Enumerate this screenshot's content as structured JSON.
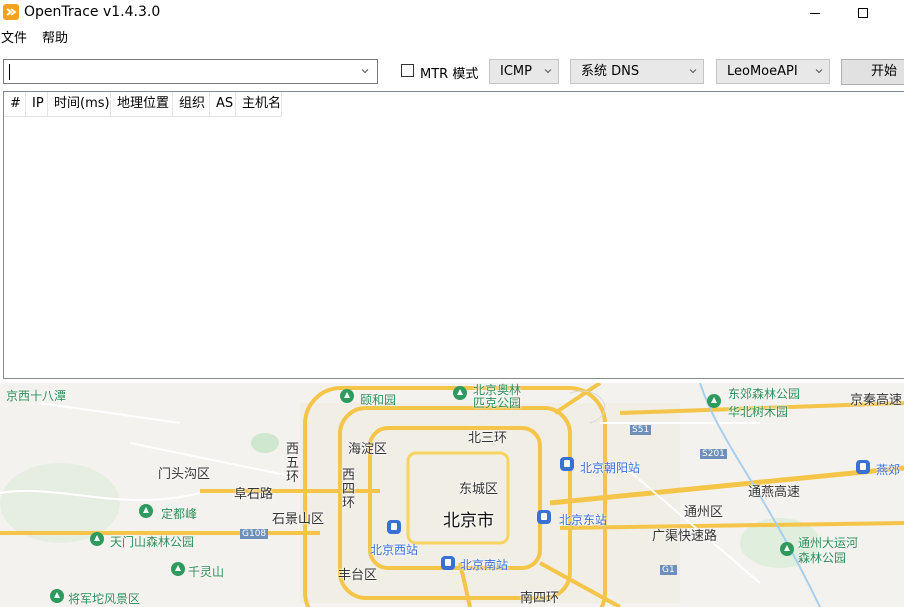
{
  "window": {
    "title": "OpenTrace v1.4.3.0"
  },
  "menu": {
    "items": [
      "文件",
      "帮助"
    ]
  },
  "toolbar": {
    "target_value": "",
    "mtr_label": "MTR 模式",
    "mtr_checked": false,
    "protocol": "ICMP",
    "dns": "系统 DNS",
    "api": "LeoMoeAPI",
    "start_label": "开始"
  },
  "table": {
    "columns": [
      "#",
      "IP",
      "时间(ms)",
      "地理位置",
      "组织",
      "AS",
      "主机名"
    ],
    "rows": []
  },
  "map": {
    "labels": {
      "jingxi": "京西十八潭",
      "yiheyuan": "颐和园",
      "aoti": "北京奥林匹克公园",
      "dongjiao": "东郊森林公园",
      "huabei": "华北树木园",
      "jingqin": "京秦高速",
      "haidian": "海淀区",
      "beisanhuan": "北三环",
      "mentougou": "门头沟区",
      "xiwuhuan": "西五环",
      "chaoyangzhan": "北京朝阳站",
      "yanjiao": "燕郊",
      "fushilu": "阜石路",
      "xisihuan": "西四环",
      "dongcheng": "东城区",
      "tongzhou": "通州区",
      "jingyan": "通燕高速",
      "dingdufeng": "定都峰",
      "shijingshan": "石景山区",
      "beijing": "北京市",
      "dongzhan": "北京东站",
      "guangqu": "广渠快速路",
      "tianmenshan": "天门山森林公园",
      "xizhan": "北京西站",
      "g108": "G108",
      "yunhe": "通州大运河森林公园",
      "lingshan": "千灵山",
      "fengtai": "丰台区",
      "nanzhan": "北京南站",
      "jiangjun": "将军坨风景区",
      "nansihuan": "南四环",
      "s51": "S51",
      "s201": "S201",
      "g1": "G1"
    }
  }
}
